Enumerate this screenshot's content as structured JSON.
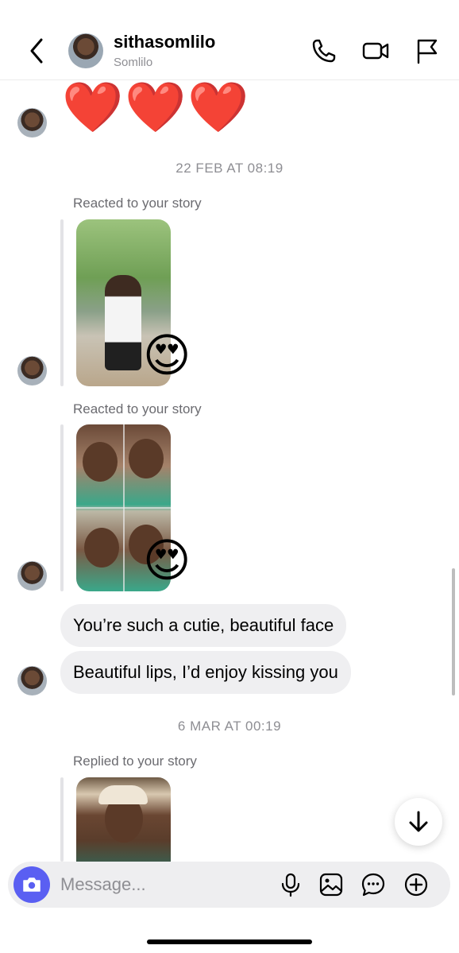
{
  "header": {
    "username": "sithasomlilo",
    "subtitle": "Somlilo"
  },
  "messages": {
    "hearts": "❤️❤️❤️",
    "date1": "22 FEB AT 08:19",
    "story_reaction_1": {
      "label": "Reacted to your story",
      "emoji": "😍"
    },
    "story_reaction_2": {
      "label": "Reacted to your story",
      "emoji": "😍"
    },
    "bubble_1": "You’re such a cutie, beautiful face",
    "bubble_2": "Beautiful lips, I’d enjoy kissing you",
    "date2": "6 MAR AT 00:19",
    "story_reply": {
      "label": "Replied to your story"
    }
  },
  "composer": {
    "placeholder": "Message..."
  },
  "icons": {
    "back": "chevron-left-icon",
    "call": "phone-icon",
    "video": "video-camera-icon",
    "report": "flag-icon",
    "camera": "camera-icon",
    "mic": "microphone-icon",
    "gallery": "image-icon",
    "sticker": "chat-bubble-icon",
    "more": "plus-circle-icon",
    "scroll": "arrow-down-icon"
  },
  "colors": {
    "accent": "#5a5ff2",
    "bubble": "#efeff1",
    "muted_text": "#8e8e93"
  }
}
